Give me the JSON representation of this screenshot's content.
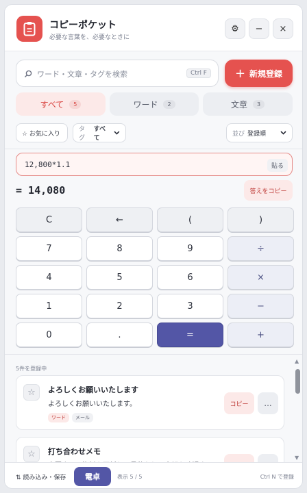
{
  "app": {
    "title": "コピーポケット",
    "subtitle": "必要な言葉を、必要なときに"
  },
  "header_buttons": {
    "settings_icon": "⚙",
    "minimize_icon": "−",
    "close_icon": "×"
  },
  "search": {
    "placeholder": "ワード・文章・タグを検索",
    "shortcut": "Ctrl F"
  },
  "new_button": {
    "icon": "+",
    "label": "新規登録"
  },
  "tabs": [
    {
      "label": "すべて",
      "count": "5"
    },
    {
      "label": "ワード",
      "count": "2"
    },
    {
      "label": "文章",
      "count": "3"
    }
  ],
  "filters": {
    "favorites": "☆ お気に入り",
    "tag_label": "タグ",
    "tag_value": "すべて",
    "sort_label": "並び",
    "sort_value": "登録順"
  },
  "calculator": {
    "expression": "12,800*1.1",
    "paste_label": "貼る",
    "result": "= 14,080",
    "copy_answer": "答えをコピー",
    "keys": [
      "C",
      "←",
      "(",
      ")",
      "7",
      "8",
      "9",
      "÷",
      "4",
      "5",
      "6",
      "×",
      "1",
      "2",
      "3",
      "−",
      "0",
      ".",
      "=",
      "+"
    ]
  },
  "list": {
    "header": "5件を登録中",
    "items": [
      {
        "title": "よろしくお願いいたします",
        "body": "よろしくお願いいたします。",
        "tags": [
          "ワード",
          "メール"
        ],
        "copy": "コピー",
        "more": "..."
      },
      {
        "title": "打ち合わせメモ",
        "body": "次回までに資料を更新し、見積もりの金額を確認する。",
        "tags": [],
        "copy": "コピー",
        "more": "..."
      }
    ]
  },
  "footer": {
    "io_label": "⇅ 読み込み・保存",
    "calc_label": "電卓",
    "shown": "表示 5 / 5",
    "hint": "Ctrl N で登録"
  },
  "colors": {
    "accent": "#e5524f",
    "calc_accent": "#5356a6"
  }
}
